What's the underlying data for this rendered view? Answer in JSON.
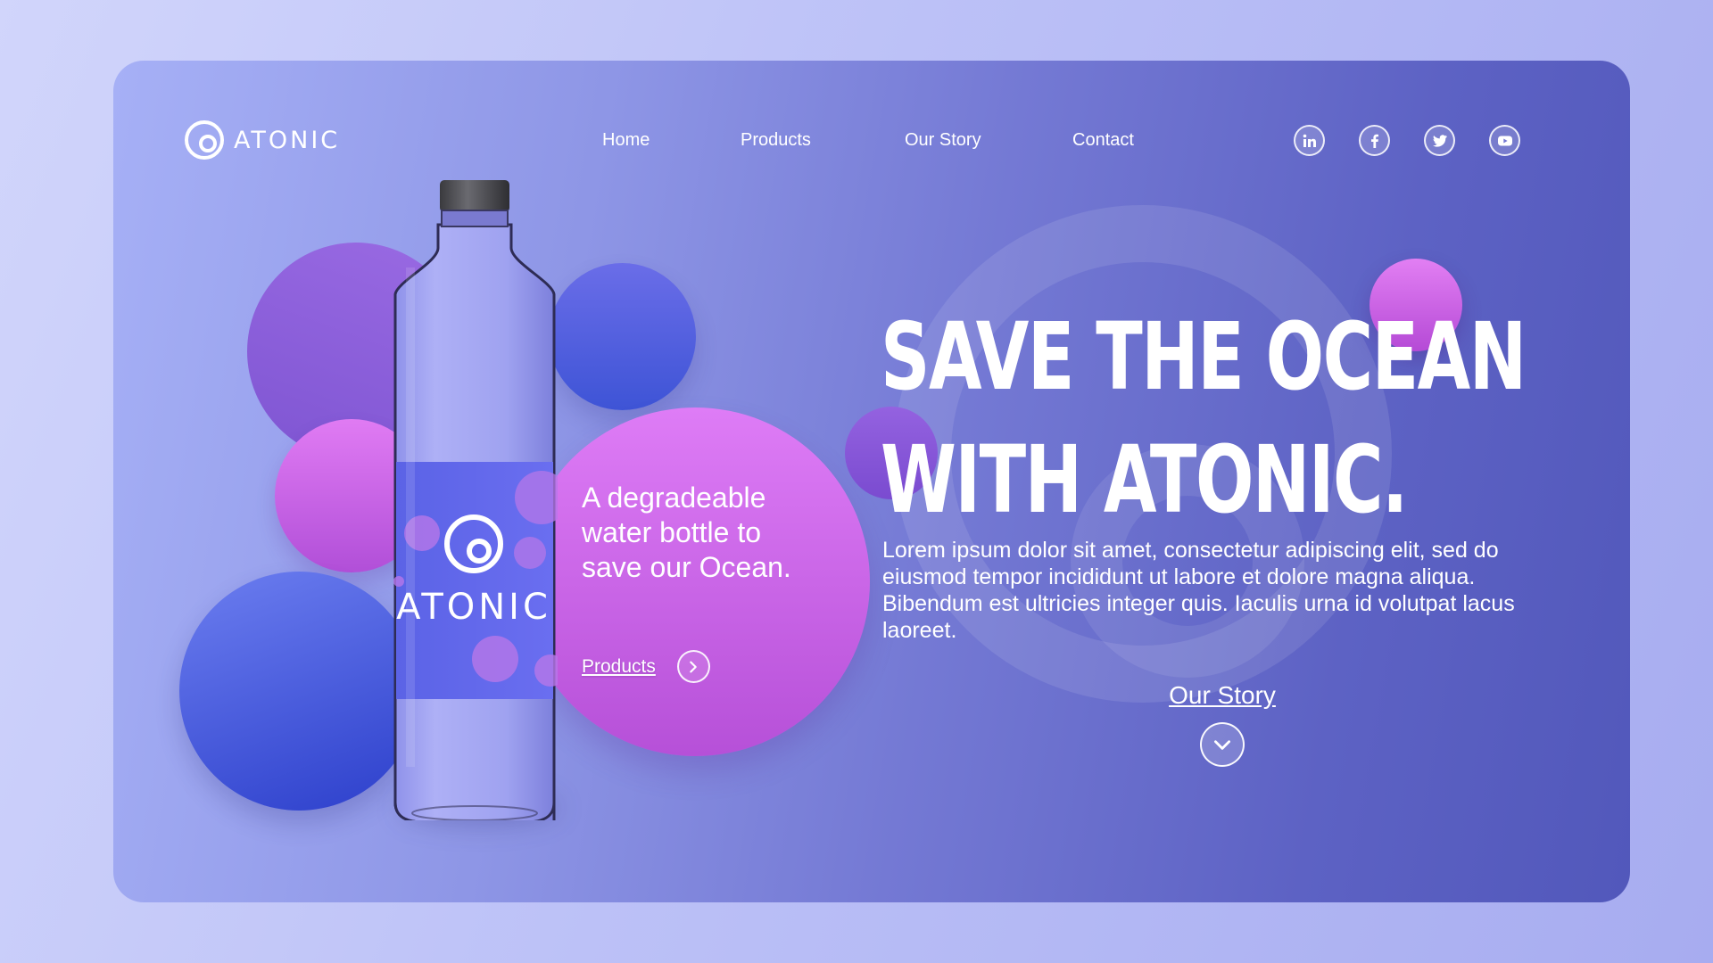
{
  "brand": {
    "name": "ATONIC",
    "logo_icon": "atonic-swirl-icon"
  },
  "nav": {
    "items": [
      {
        "label": "Home"
      },
      {
        "label": "Products"
      },
      {
        "label": "Our Story"
      },
      {
        "label": "Contact"
      }
    ]
  },
  "social": [
    {
      "icon": "linkedin-icon",
      "label": "in"
    },
    {
      "icon": "facebook-icon",
      "label": "f"
    },
    {
      "icon": "twitter-icon",
      "label": ""
    },
    {
      "icon": "youtube-icon",
      "label": ""
    }
  ],
  "bottle": {
    "label_text": "ATONIC"
  },
  "promo": {
    "tagline": "A degradeable water bottle to save our Ocean.",
    "cta_label": "Products",
    "cta_icon": "chevron-right-icon"
  },
  "hero": {
    "headline_line1": "SAVE THE OCEAN",
    "headline_line2": "WITH ATONIC.",
    "body": "Lorem ipsum dolor sit amet, consectetur adipiscing elit, sed do eiusmod tempor incididunt ut labore et dolore magna aliqua. Bibendum est ultricies integer quis. Iaculis urna id volutpat lacus laoreet.",
    "story_label": "Our Story",
    "story_icon": "chevron-down-icon"
  },
  "colors": {
    "page_bg": "#c4c8f8",
    "card_start": "#a6b0f6",
    "card_end": "#5258bb",
    "accent_pink": "#d070ee",
    "accent_blue": "#3e54d6",
    "text": "#ffffff"
  }
}
